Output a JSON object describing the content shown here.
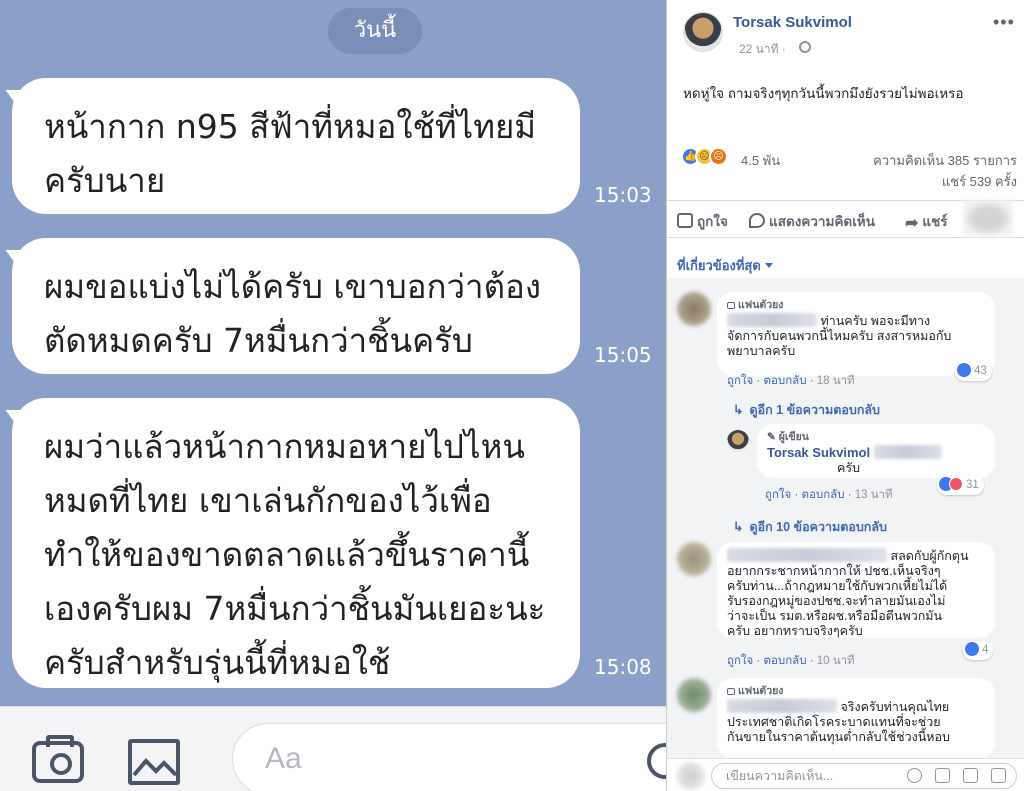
{
  "chat": {
    "date_label": "วันนี้",
    "messages": [
      {
        "text": "หน้ากาก n95 สีฟ้าที่หมอใช้ที่ไทยมี\nครับนาย",
        "time": "15:03"
      },
      {
        "text": "ผมขอแบ่งไม่ได้ครับ เขาบอกว่าต้อง\nตัดหมดครับ 7หมื่นกว่าชิ้นครับ",
        "time": "15:05"
      },
      {
        "text": "ผมว่าแล้วหน้ากากหมอหายไปไหน\nหมดที่ไทย เขาเล่นกักของไว้เพื่อ\nทำให้ของขาดตลาดแล้วขึ้นราคานี้\nเองครับผม 7หมื่นกว่าชิ้นมันเยอะนะ\nครับสำหรับรุ่นนี้ที่หมอใช้",
        "time": "15:08"
      }
    ],
    "input_placeholder": "Aa",
    "icons": [
      "camera-icon",
      "image-icon",
      "emoji-icon"
    ]
  },
  "post": {
    "author": "Torsak Sukvimol",
    "time": "22 นาที ·",
    "text": "หดหู่ใจ ถามจริงๆทุกวันนี้พวกมึงยังรวยไม่พอเหรอ",
    "reaction_count": "4.5 พัน",
    "comment_count": "ความคิดเห็น 385 รายการ",
    "share_count": "แชร์ 539 ครั้ง",
    "actions": {
      "like": "ถูกใจ",
      "comment": "แสดงความคิดเห็น",
      "share": "แชร์"
    },
    "sort_label": "ที่เกี่ยวข้องที่สุด"
  },
  "comments": [
    {
      "badge": "แฟนตัวยง",
      "text": "ท่านครับ พอจะมีทาง\nจัดการกับคนพวกนี้ไหมครับ สงสารหมอกับ\nพยาบาลครับ",
      "like_label": "ถูกใจ",
      "reply_label": "ตอบกลับ",
      "time": "18 นาที",
      "likes": "43",
      "more_replies": "ดูอีก 1 ข้อความตอบกลับ",
      "reply": {
        "badge": "ผู้เขียน",
        "author": "Torsak Sukvimol",
        "text": "ครับ",
        "like_label": "ถูกใจ",
        "reply_label": "ตอบกลับ",
        "time": "13 นาที",
        "likes": "31"
      },
      "more_replies_2": "ดูอีก 10 ข้อความตอบกลับ"
    },
    {
      "text_first": "สลดกับผู้กักตุน",
      "text": "อยากกระชากหน้ากากให้ ปชช.เห็นจริงๆ\nครับท่าน...ถ้ากฎหมายใช้กับพวกเหี้ยไม่ได้\nรับรองกฎหมู่ของปชช.จะทำลายมันเองไม่\nว่าจะเป็น รมต.หรือผช.หรือมือตีนพวกมัน\nครับ อยากทราบจริงๆครับ",
      "like_label": "ถูกใจ",
      "reply_label": "ตอบกลับ",
      "time": "10 นาที",
      "likes": "4"
    },
    {
      "badge": "แฟนตัวยง",
      "text_first": "จริงครับท่านคุณไทย",
      "text": "ประเทศชาติเกิดโรคระบาดแทนที่จะช่วย\nกันขายในราคาต้นทุนต่ำกลับใช้ช่วงนี้หอบ"
    }
  ],
  "write_comment_placeholder": "เขียนความคิดเห็น...",
  "colors": {
    "chat_bg": "#8aa0c8",
    "fb_link": "#385898",
    "fb_blue": "#4267b2"
  }
}
